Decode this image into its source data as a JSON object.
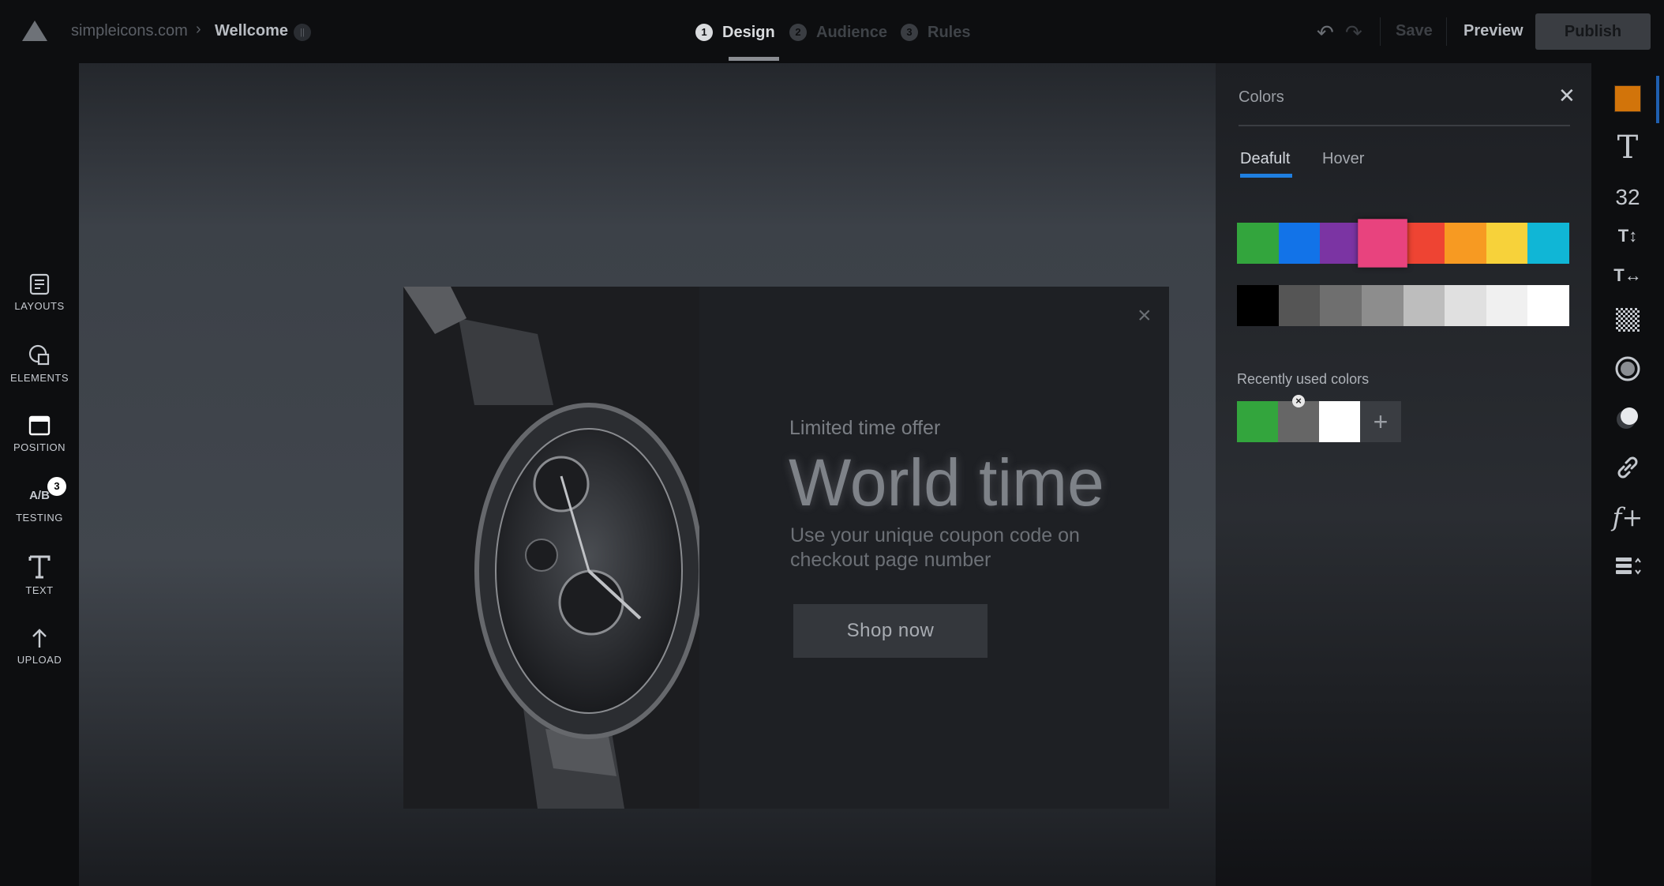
{
  "header": {
    "breadcrumb": {
      "site": "simpleicons.com",
      "separator": "›",
      "page": "Wellcome",
      "badge": "||"
    },
    "steps": [
      {
        "number": "1",
        "label": "Design",
        "active": true
      },
      {
        "number": "2",
        "label": "Audience",
        "active": false
      },
      {
        "number": "3",
        "label": "Rules",
        "active": false
      }
    ],
    "actions": {
      "undo": "↶",
      "redo": "↷",
      "save": "Save",
      "preview": "Preview",
      "publish": "Publish"
    }
  },
  "left_tools": [
    {
      "icon": "layouts-icon",
      "label": "LAYOUTS"
    },
    {
      "icon": "elements-icon",
      "label": "ELEMENTS"
    },
    {
      "icon": "position-icon",
      "label": "POSITION"
    },
    {
      "icon": "ab-testing-icon",
      "icon_text": "A/B",
      "label": "TESTING",
      "badge": "3"
    },
    {
      "icon": "text-icon",
      "label": "TEXT"
    },
    {
      "icon": "upload-icon",
      "label": "UPLOAD"
    }
  ],
  "popup": {
    "close": "×",
    "offer": "Limited time offer",
    "headline": "World time",
    "subline": "Use your unique coupon code on checkout page number",
    "cta": "Shop now"
  },
  "colors_panel": {
    "title": "Colors",
    "close": "✕",
    "tabs": [
      {
        "label": "Deafult",
        "active": true
      },
      {
        "label": "Hover",
        "active": false
      }
    ],
    "palette_row1": [
      "#33a53d",
      "#1273e8",
      "#7b34a3",
      "#e8437e",
      "#ee4433",
      "#f79a22",
      "#f7d23a",
      "#10b6d6"
    ],
    "palette_row1_selected_index": 3,
    "palette_row2": [
      "#000000",
      "#555555",
      "#6f6f6f",
      "#8d8d8d",
      "#bdbdbd",
      "#e0e0e0",
      "#f0f0f0",
      "#ffffff"
    ],
    "recent_title": "Recently used colors",
    "recent": [
      "#33a53d",
      "#666666",
      "#ffffff"
    ],
    "recent_remove": "×",
    "add": "+"
  },
  "right_tools": [
    {
      "icon": "color-swatch-icon",
      "color": "#d2740a"
    },
    {
      "icon": "font-icon",
      "text": "T"
    },
    {
      "icon": "font-size-value",
      "text": "32"
    },
    {
      "icon": "line-height-icon",
      "text": "T↕"
    },
    {
      "icon": "letter-spacing-icon",
      "text": "T↔"
    },
    {
      "icon": "transparency-icon"
    },
    {
      "icon": "shadow-icon"
    },
    {
      "icon": "glow-icon"
    },
    {
      "icon": "link-icon"
    },
    {
      "icon": "function-icon",
      "text": "f+"
    },
    {
      "icon": "align-icon"
    }
  ]
}
